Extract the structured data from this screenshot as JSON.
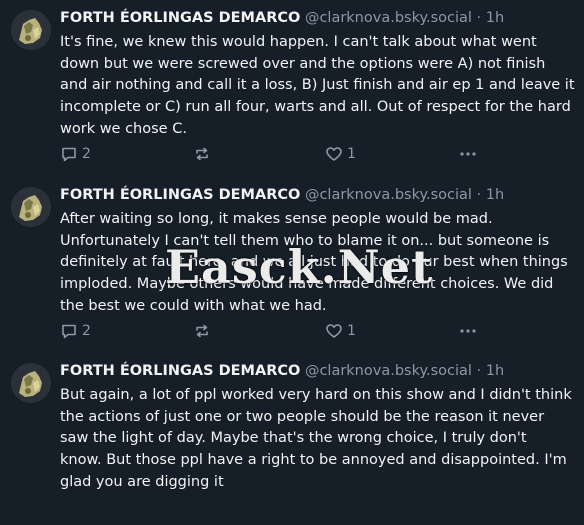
{
  "watermark": "Easck.Net",
  "posts": [
    {
      "author": "FORTH ÉORLINGAS DEMARCO",
      "handle": "@clarknova.bsky.social",
      "separator": "·",
      "time": "1h",
      "text": "It's fine, we knew this would happen. I can't talk about what went\ndown but we were screwed over and the options were A) not finish\nand air nothing and call it a loss, B) Just finish and air ep 1 and leave it\nincomplete or C) run all four, warts and all. Out of respect for the hard\nwork we chose C.",
      "replies": "2",
      "likes": "1"
    },
    {
      "author": "FORTH ÉORLINGAS DEMARCO",
      "handle": "@clarknova.bsky.social",
      "separator": "·",
      "time": "1h",
      "text": "After waiting so long, it makes sense people would be mad.\nUnfortunately I can't tell them who to blame it on... but someone is\ndefinitely at fault here, and we all just had to do our best when things\nimploded. Maybe others would have made different choices. We did\nthe best we could with what we had.",
      "replies": "2",
      "likes": "1"
    },
    {
      "author": "FORTH ÉORLINGAS DEMARCO",
      "handle": "@clarknova.bsky.social",
      "separator": "·",
      "time": "1h",
      "text": "But again, a lot of ppl worked very hard on this show and I didn't think\nthe actions of just one or two people should be the reason it never\nsaw the light of day. Maybe that's the wrong choice, I truly don't\nknow. But those ppl have a right to be annoyed and disappointed. I'm\nglad you are digging it"
    }
  ]
}
